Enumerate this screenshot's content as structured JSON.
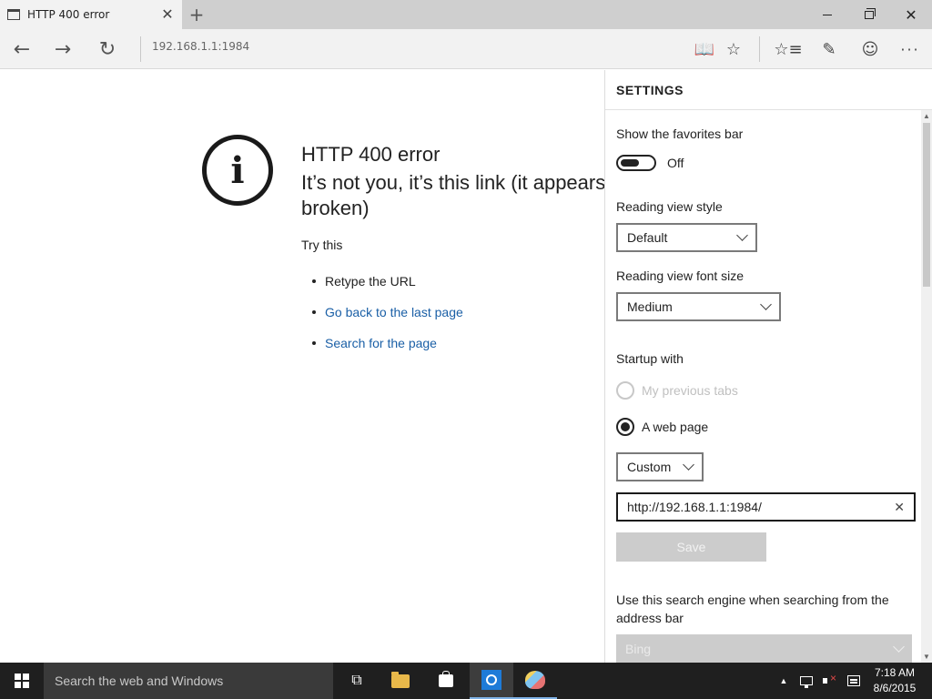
{
  "tab": {
    "title": "HTTP 400 error",
    "close_glyph": "✕",
    "new_tab_glyph": "+"
  },
  "window_controls": {
    "close_glyph": "✕"
  },
  "nav": {
    "back_glyph": "←",
    "forward_glyph": "→",
    "refresh_glyph": "↻",
    "address": "192.168.1.1:1984",
    "reading_glyph": "📖",
    "favorite_glyph": "☆",
    "hub_glyph": "☆≡",
    "note_glyph": "✎",
    "feedback_glyph": "☺",
    "more_glyph": "···"
  },
  "error_page": {
    "icon_glyph": "i",
    "title": "HTTP 400 error",
    "message": "It’s not you, it’s this link (it appears to be broken)",
    "try_this": "Try this",
    "suggestions": [
      {
        "text": "Retype the URL"
      },
      {
        "text": "Go back to the last page"
      },
      {
        "text": "Search for the page"
      }
    ]
  },
  "settings": {
    "title": "SETTINGS",
    "favorites_bar_label": "Show the favorites bar",
    "favorites_bar_state": "Off",
    "reading_style_label": "Reading view style",
    "reading_style_value": "Default",
    "reading_font_label": "Reading view font size",
    "reading_font_value": "Medium",
    "startup_label": "Startup with",
    "startup_option_prev": "My previous tabs",
    "startup_option_web": "A web page",
    "startup_page_type": "Custom",
    "startup_url": "http://192.168.1.1:1984/",
    "clear_glyph": "✕",
    "save_label": "Save",
    "search_engine_label": "Use this search engine when searching from the address bar",
    "search_engine_value": "Bing",
    "scroll_up_glyph": "▲",
    "scroll_down_glyph": "▼"
  },
  "taskbar": {
    "search_placeholder": "Search the web and Windows",
    "task_view_glyph": "⧉",
    "tray_up_glyph": "▲",
    "time": "7:18 AM",
    "date": "8/6/2015"
  },
  "colors": {
    "link": "#1a5fa6",
    "taskbar": "#1f1f1f",
    "edge_blue": "#1e7bd8",
    "disabled_gray": "#cccccc"
  },
  "icons": [
    "tab-page-icon",
    "back-arrow-icon",
    "forward-arrow-icon",
    "refresh-icon",
    "reading-view-icon",
    "star-icon",
    "hub-icon",
    "web-note-icon",
    "feedback-smiley-icon",
    "more-icon",
    "info-circle-icon",
    "windows-logo-icon",
    "task-view-icon",
    "file-explorer-icon",
    "store-icon",
    "edge-icon",
    "paint-icon",
    "network-icon",
    "volume-muted-icon",
    "action-center-icon"
  ]
}
